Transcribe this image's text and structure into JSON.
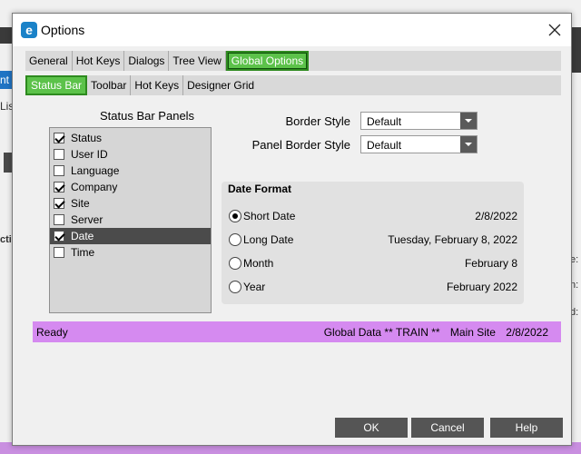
{
  "background": {
    "left_fragments": [
      "nt",
      "Lis",
      "ctic"
    ],
    "right_fragments": [
      "e:",
      "n:",
      "d:"
    ]
  },
  "dialog": {
    "title": "Options",
    "icon_letter": "e"
  },
  "tabs": [
    {
      "label": "General",
      "active": false
    },
    {
      "label": "Hot Keys",
      "active": false
    },
    {
      "label": "Dialogs",
      "active": false
    },
    {
      "label": "Tree View",
      "active": false
    },
    {
      "label": "Global Options",
      "active": true
    }
  ],
  "subtabs": [
    {
      "label": "Status Bar",
      "active": true
    },
    {
      "label": "Toolbar",
      "active": false
    },
    {
      "label": "Hot Keys",
      "active": false
    },
    {
      "label": "Designer Grid",
      "active": false
    }
  ],
  "status_bar_panels": {
    "title": "Status Bar Panels",
    "items": [
      {
        "label": "Status",
        "checked": true
      },
      {
        "label": "User ID",
        "checked": false
      },
      {
        "label": "Language",
        "checked": false
      },
      {
        "label": "Company",
        "checked": true
      },
      {
        "label": "Site",
        "checked": true
      },
      {
        "label": "Server",
        "checked": false
      },
      {
        "label": "Date",
        "checked": true,
        "selected": true
      },
      {
        "label": "Time",
        "checked": false
      }
    ]
  },
  "border_style": {
    "label": "Border Style",
    "value": "Default"
  },
  "panel_border_style": {
    "label": "Panel Border Style",
    "value": "Default"
  },
  "date_format": {
    "title": "Date Format",
    "options": [
      {
        "label": "Short Date",
        "example": "2/8/2022",
        "selected": true
      },
      {
        "label": "Long Date",
        "example": "Tuesday, February 8, 2022",
        "selected": false
      },
      {
        "label": "Month",
        "example": "February 8",
        "selected": false
      },
      {
        "label": "Year",
        "example": "February 2022",
        "selected": false
      }
    ]
  },
  "preview": {
    "status": "Ready",
    "company": "Global Data ** TRAIN **",
    "site": "Main Site",
    "date": "2/8/2022",
    "background": "#d58af0"
  },
  "buttons": {
    "ok": "OK",
    "cancel": "Cancel",
    "help": "Help"
  },
  "colors": {
    "active_tab": "#5cc24a",
    "button": "#555555",
    "selected_row": "#4b4b4b"
  }
}
